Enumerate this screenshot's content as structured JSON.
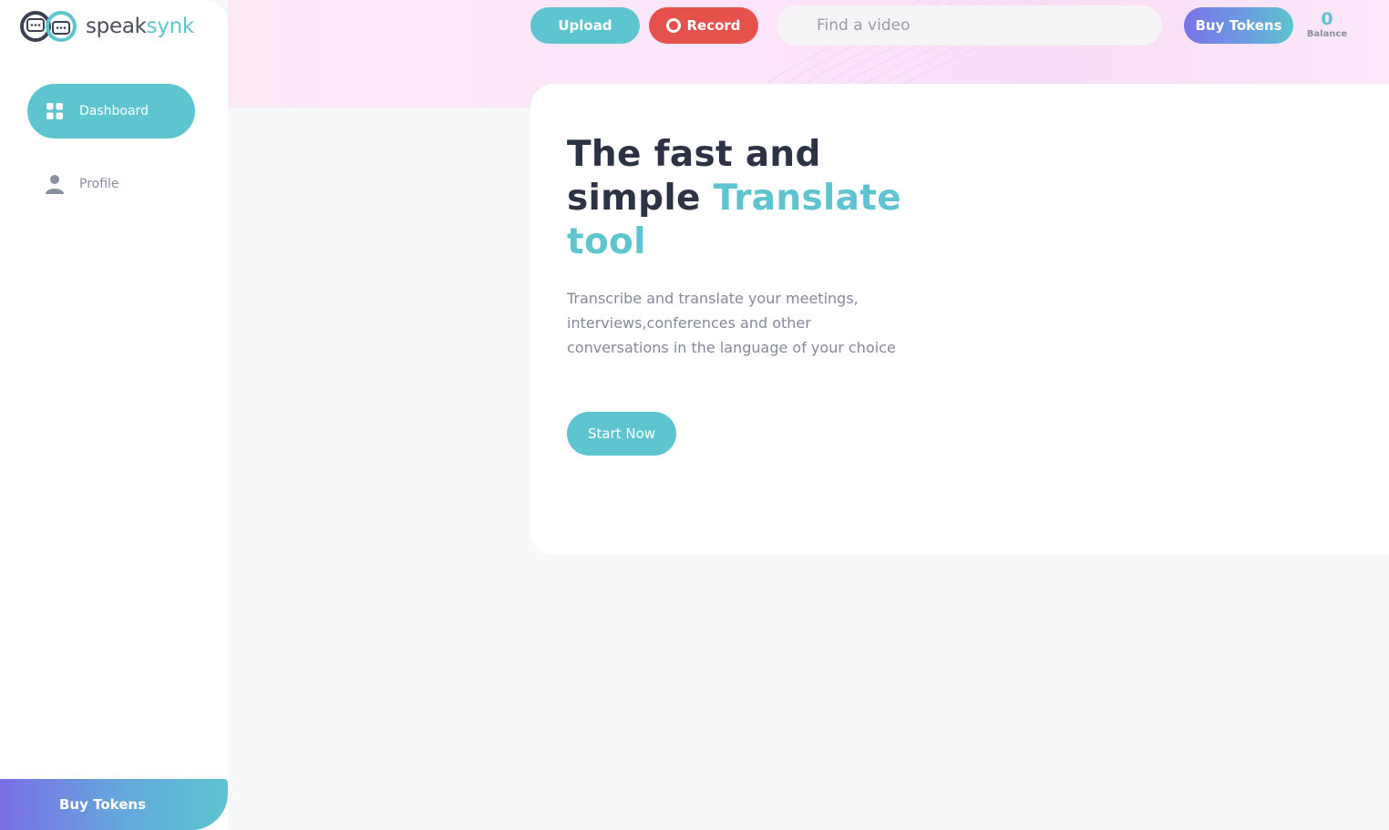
{
  "app": {
    "brand_part1": "speak",
    "brand_part2": "synk"
  },
  "sidebar": {
    "items": [
      {
        "label": "Dashboard",
        "icon": "grid-icon",
        "active": true
      },
      {
        "label": "Profile",
        "icon": "user-icon",
        "active": false
      }
    ],
    "buy_tokens_label": "Buy Tokens"
  },
  "header": {
    "upload_label": "Upload",
    "record_label": "Record",
    "search_placeholder": "Find a video",
    "buy_tokens_label": "Buy Tokens",
    "balance_value": "0",
    "balance_label": "Balance"
  },
  "hero": {
    "title_part1": "The fast and simple ",
    "title_accent": "Translate tool",
    "description": "Transcribe and translate your meetings, interviews,conferences and other conversations in the language of your choice",
    "cta_label": "Start Now"
  },
  "colors": {
    "accent": "#5ec4cf",
    "record": "#e5524c",
    "heading": "#2c3344",
    "muted": "#858a9b",
    "gradient_start": "#7a6ee6"
  }
}
